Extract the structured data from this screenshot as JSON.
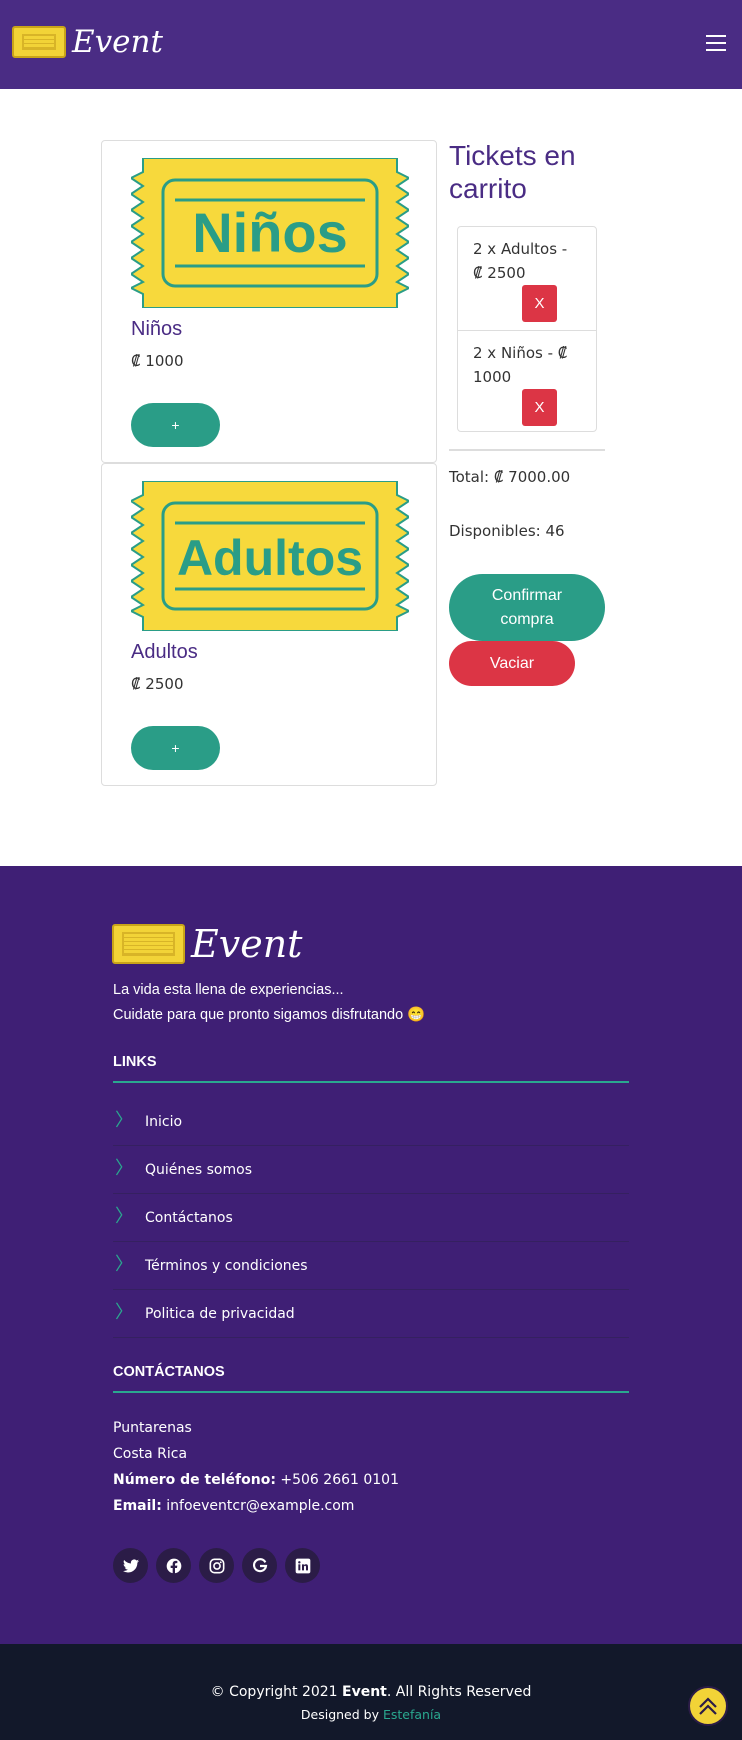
{
  "brand": {
    "name": "Event"
  },
  "header": {
    "menu_icon": "hamburger-icon"
  },
  "products": [
    {
      "name": "Niños",
      "price": "₡ 1000",
      "image_text": "Niños",
      "add_label": "+"
    },
    {
      "name": "Adultos",
      "price": "₡ 2500",
      "image_text": "Adultos",
      "add_label": "+"
    }
  ],
  "cart": {
    "title": "Tickets en carrito",
    "items": [
      {
        "text": "2 x Adultos - ₡ 2500",
        "remove_label": "X"
      },
      {
        "text": "2 x Niños - ₡ 1000",
        "remove_label": "X"
      }
    ],
    "total": "Total: ₡ 7000.00",
    "available": "Disponibles: 46",
    "confirm_label": "Confirmar compra",
    "empty_label": "Vaciar"
  },
  "footer": {
    "tagline_line1": "La vida esta llena de experiencias...",
    "tagline_line2": "Cuidate para que pronto sigamos disfrutando 😁",
    "links_title": "LINKS",
    "links": [
      "Inicio",
      "Quiénes somos",
      "Contáctanos",
      "Términos y condiciones",
      "Politica de privacidad"
    ],
    "contact_title": "CONTÁCTANOS",
    "address_line1": "Puntarenas",
    "address_line2": "Costa Rica",
    "phone_label": "Número de teléfono:",
    "phone": "+506 2661 0101",
    "email_label": "Email:",
    "email": "infoeventcr@example.com",
    "socials": [
      {
        "icon": "twitter-icon",
        "glyph": "🐦"
      },
      {
        "icon": "facebook-icon",
        "glyph": "f"
      },
      {
        "icon": "instagram-icon",
        "glyph": "◎"
      },
      {
        "icon": "google-icon",
        "glyph": "G"
      },
      {
        "icon": "linkedin-icon",
        "glyph": "in"
      }
    ]
  },
  "bottom": {
    "copyright_prefix": "© Copyright 2021",
    "copyright_brand": "Event",
    "copyright_suffix": ". All Rights Reserved",
    "designed_by": "Designed by",
    "designer": "Estefanía"
  },
  "colors": {
    "header": "#4a2c84",
    "footer": "#3f1f75",
    "accent": "#2a9d87",
    "danger": "#dc3545",
    "ticket": "#f2d337"
  }
}
